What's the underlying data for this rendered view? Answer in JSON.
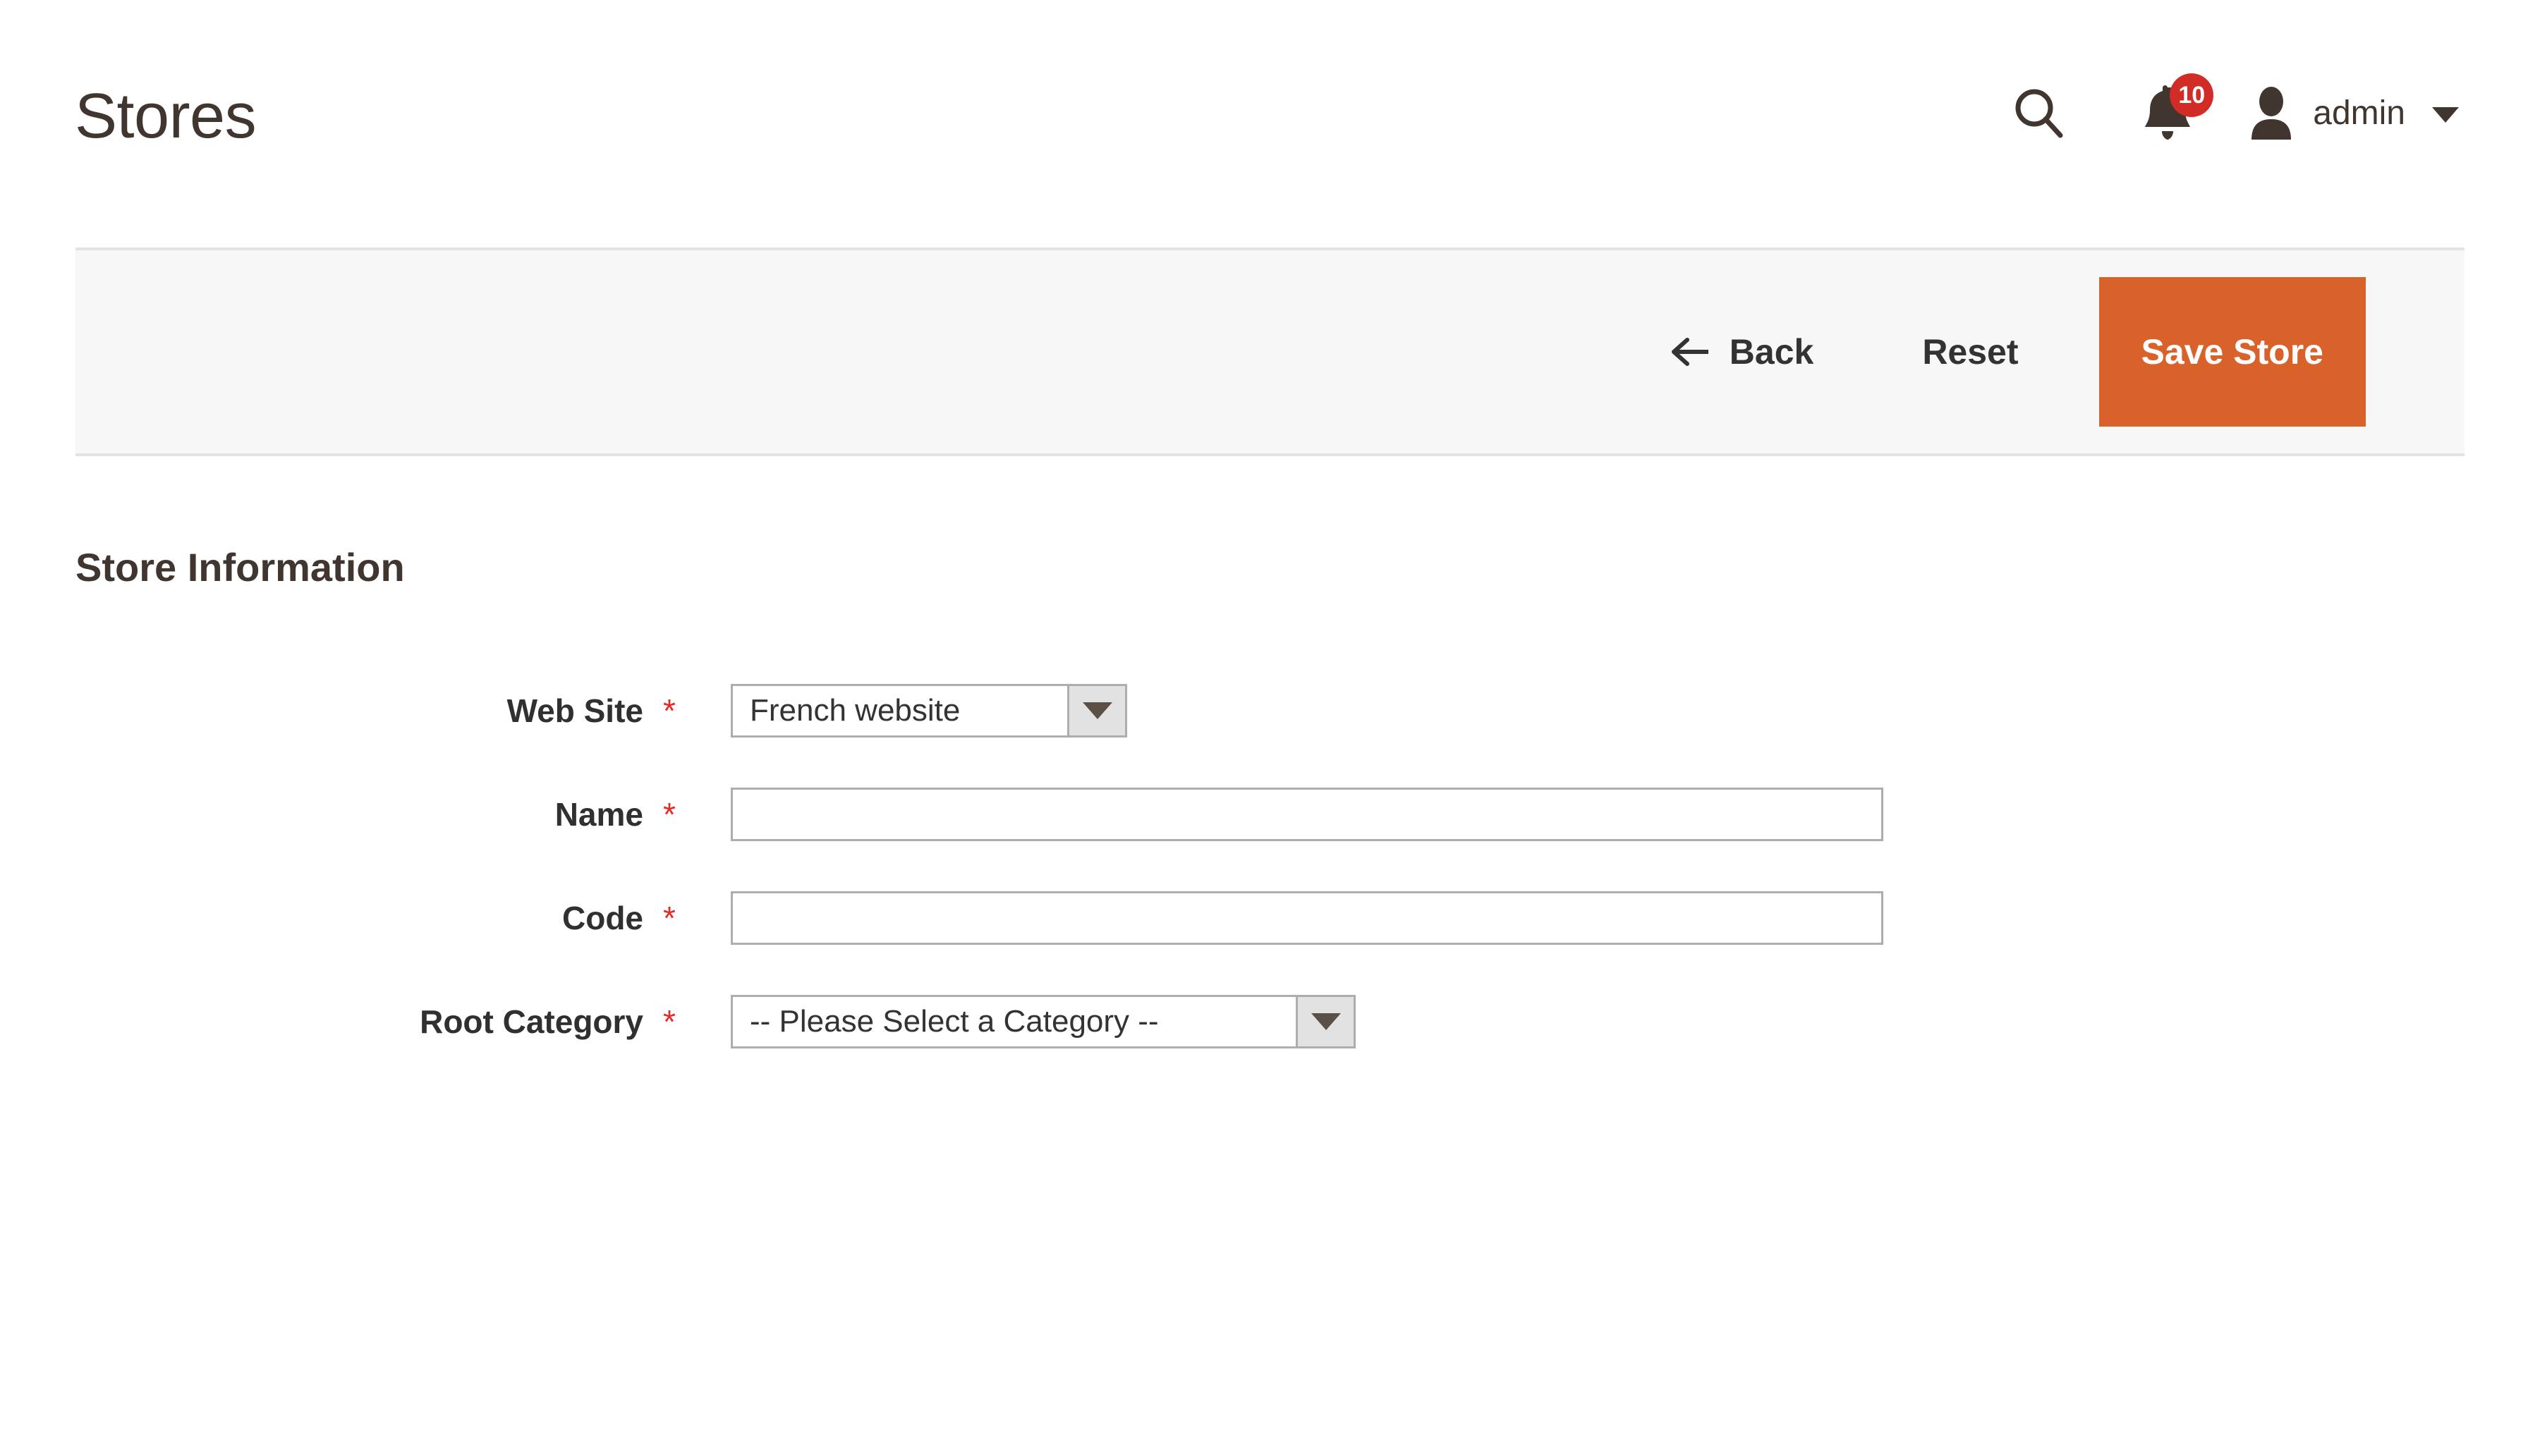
{
  "header": {
    "title": "Stores",
    "search_icon": "search-icon",
    "notifications": {
      "icon": "bell-icon",
      "count": "10"
    },
    "user": {
      "avatar_icon": "user-avatar-icon",
      "name": "admin",
      "caret_icon": "chevron-down-icon"
    }
  },
  "toolbar": {
    "back_label": "Back",
    "back_icon": "arrow-left-icon",
    "reset_label": "Reset",
    "save_label": "Save Store",
    "save_color": "#d9622a"
  },
  "form": {
    "legend": "Store Information",
    "required_marker": "*",
    "fields": [
      {
        "label": "Web Site",
        "type": "select",
        "value": "French website",
        "required": true
      },
      {
        "label": "Name",
        "type": "text",
        "value": "",
        "placeholder": "",
        "required": true
      },
      {
        "label": "Code",
        "type": "text",
        "value": "",
        "placeholder": "",
        "required": true
      },
      {
        "label": "Root Category",
        "type": "select",
        "value": "-- Please Select a Category --",
        "required": true
      }
    ]
  },
  "colors": {
    "accent_orange": "#d9622a",
    "badge_red": "#d12d26",
    "required_red": "#e02b27",
    "title_brown": "#41362f",
    "toolbar_bg": "#f7f7f7",
    "border_gray": "#adadad"
  }
}
